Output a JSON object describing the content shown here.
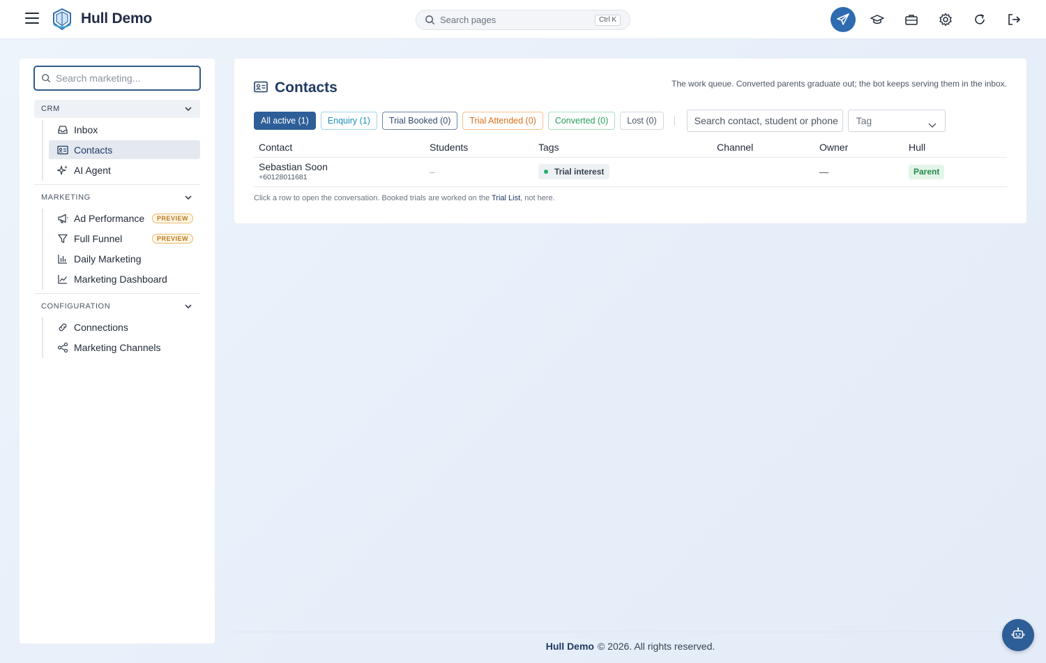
{
  "app": {
    "brand": "Hull Demo",
    "search_placeholder": "Search pages",
    "search_shortcut": "Ctrl K"
  },
  "top_icons": [
    "send-icon",
    "graduation-cap-icon",
    "briefcase-icon",
    "gear-icon",
    "refresh-icon",
    "logout-icon"
  ],
  "sidebar": {
    "search_placeholder": "Search marketing...",
    "sections": [
      {
        "label": "CRM",
        "items": [
          {
            "label": "Inbox",
            "icon": "inbox-icon"
          },
          {
            "label": "Contacts",
            "icon": "contact-card-icon",
            "active": true
          },
          {
            "label": "AI Agent",
            "icon": "sparkles-icon"
          }
        ]
      },
      {
        "label": "MARKETING",
        "items": [
          {
            "label": "Ad Performance",
            "icon": "megaphone-icon",
            "badge": "PREVIEW"
          },
          {
            "label": "Full Funnel",
            "icon": "funnel-icon",
            "badge": "PREVIEW"
          },
          {
            "label": "Daily Marketing",
            "icon": "bar-chart-icon"
          },
          {
            "label": "Marketing Dashboard",
            "icon": "line-chart-icon"
          }
        ]
      },
      {
        "label": "CONFIGURATION",
        "items": [
          {
            "label": "Connections",
            "icon": "link-icon"
          },
          {
            "label": "Marketing Channels",
            "icon": "share-icon"
          }
        ]
      }
    ]
  },
  "main": {
    "title": "Contacts",
    "subtitle": "The work queue. Converted parents graduate out; the bot keeps serving them in the inbox.",
    "filters": [
      {
        "label": "All active (1)",
        "active": true,
        "color": "#2e5e97"
      },
      {
        "label": "Enquiry (1)",
        "color": "#1e8fb7"
      },
      {
        "label": "Trial Booked (0)",
        "color": "#2f4a6d"
      },
      {
        "label": "Trial Attended (0)",
        "color": "#d9711c"
      },
      {
        "label": "Converted (0)",
        "color": "#27a05a"
      },
      {
        "label": "Lost (0)",
        "color": "#4b5563"
      }
    ],
    "contact_search_placeholder": "Search contact, student or phone",
    "tag_select": "Tag",
    "table": {
      "columns": [
        "Contact",
        "Students",
        "Tags",
        "Channel",
        "Owner",
        "Hull"
      ],
      "rows": [
        {
          "name": "Sebastian Soon",
          "phone": "+60128011681",
          "students": "–",
          "tag": "Trial interest",
          "channel": "",
          "owner": "—",
          "hull": "Parent"
        }
      ]
    },
    "footnote_prefix": "Click a row to open the conversation. Booked trials are worked on the ",
    "footnote_link": "Trial List",
    "footnote_suffix": ", not here."
  },
  "footer": {
    "brand": "Hull Demo",
    "text": "© 2026. All rights reserved."
  },
  "colors": {
    "accent": "#2e5e97",
    "brand_text": "#1f3a63",
    "tag_dot": "#22b26b",
    "preview_badge": "#b7791f"
  }
}
